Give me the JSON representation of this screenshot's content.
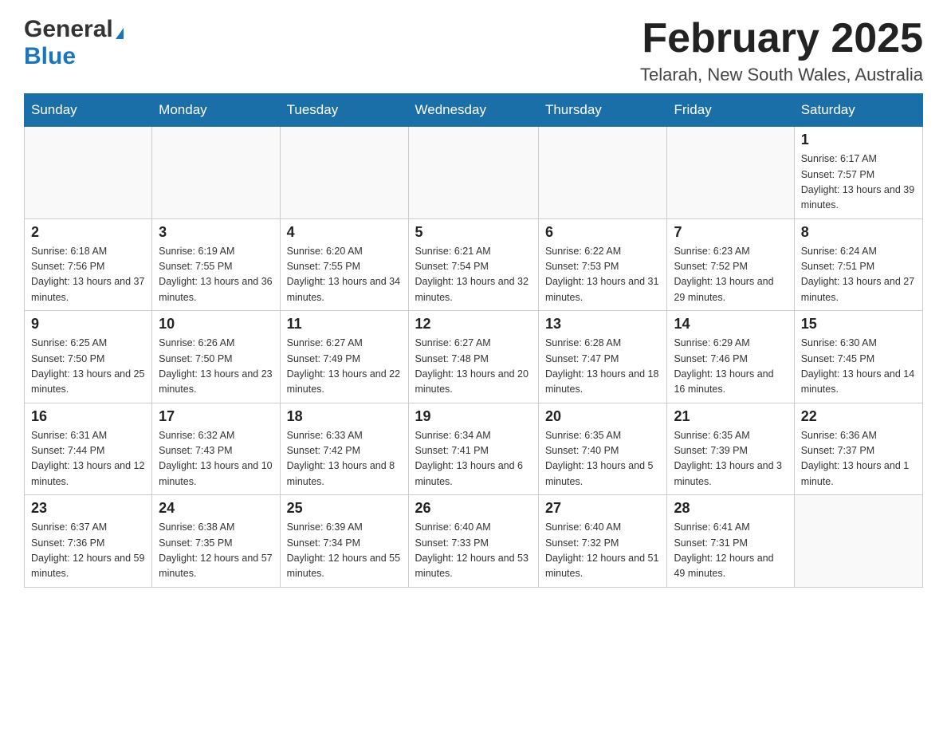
{
  "header": {
    "logo_general": "General",
    "logo_blue": "Blue",
    "month_title": "February 2025",
    "location": "Telarah, New South Wales, Australia"
  },
  "weekdays": [
    "Sunday",
    "Monday",
    "Tuesday",
    "Wednesday",
    "Thursday",
    "Friday",
    "Saturday"
  ],
  "weeks": [
    [
      {
        "day": "",
        "sunrise": "",
        "sunset": "",
        "daylight": ""
      },
      {
        "day": "",
        "sunrise": "",
        "sunset": "",
        "daylight": ""
      },
      {
        "day": "",
        "sunrise": "",
        "sunset": "",
        "daylight": ""
      },
      {
        "day": "",
        "sunrise": "",
        "sunset": "",
        "daylight": ""
      },
      {
        "day": "",
        "sunrise": "",
        "sunset": "",
        "daylight": ""
      },
      {
        "day": "",
        "sunrise": "",
        "sunset": "",
        "daylight": ""
      },
      {
        "day": "1",
        "sunrise": "Sunrise: 6:17 AM",
        "sunset": "Sunset: 7:57 PM",
        "daylight": "Daylight: 13 hours and 39 minutes."
      }
    ],
    [
      {
        "day": "2",
        "sunrise": "Sunrise: 6:18 AM",
        "sunset": "Sunset: 7:56 PM",
        "daylight": "Daylight: 13 hours and 37 minutes."
      },
      {
        "day": "3",
        "sunrise": "Sunrise: 6:19 AM",
        "sunset": "Sunset: 7:55 PM",
        "daylight": "Daylight: 13 hours and 36 minutes."
      },
      {
        "day": "4",
        "sunrise": "Sunrise: 6:20 AM",
        "sunset": "Sunset: 7:55 PM",
        "daylight": "Daylight: 13 hours and 34 minutes."
      },
      {
        "day": "5",
        "sunrise": "Sunrise: 6:21 AM",
        "sunset": "Sunset: 7:54 PM",
        "daylight": "Daylight: 13 hours and 32 minutes."
      },
      {
        "day": "6",
        "sunrise": "Sunrise: 6:22 AM",
        "sunset": "Sunset: 7:53 PM",
        "daylight": "Daylight: 13 hours and 31 minutes."
      },
      {
        "day": "7",
        "sunrise": "Sunrise: 6:23 AM",
        "sunset": "Sunset: 7:52 PM",
        "daylight": "Daylight: 13 hours and 29 minutes."
      },
      {
        "day": "8",
        "sunrise": "Sunrise: 6:24 AM",
        "sunset": "Sunset: 7:51 PM",
        "daylight": "Daylight: 13 hours and 27 minutes."
      }
    ],
    [
      {
        "day": "9",
        "sunrise": "Sunrise: 6:25 AM",
        "sunset": "Sunset: 7:50 PM",
        "daylight": "Daylight: 13 hours and 25 minutes."
      },
      {
        "day": "10",
        "sunrise": "Sunrise: 6:26 AM",
        "sunset": "Sunset: 7:50 PM",
        "daylight": "Daylight: 13 hours and 23 minutes."
      },
      {
        "day": "11",
        "sunrise": "Sunrise: 6:27 AM",
        "sunset": "Sunset: 7:49 PM",
        "daylight": "Daylight: 13 hours and 22 minutes."
      },
      {
        "day": "12",
        "sunrise": "Sunrise: 6:27 AM",
        "sunset": "Sunset: 7:48 PM",
        "daylight": "Daylight: 13 hours and 20 minutes."
      },
      {
        "day": "13",
        "sunrise": "Sunrise: 6:28 AM",
        "sunset": "Sunset: 7:47 PM",
        "daylight": "Daylight: 13 hours and 18 minutes."
      },
      {
        "day": "14",
        "sunrise": "Sunrise: 6:29 AM",
        "sunset": "Sunset: 7:46 PM",
        "daylight": "Daylight: 13 hours and 16 minutes."
      },
      {
        "day": "15",
        "sunrise": "Sunrise: 6:30 AM",
        "sunset": "Sunset: 7:45 PM",
        "daylight": "Daylight: 13 hours and 14 minutes."
      }
    ],
    [
      {
        "day": "16",
        "sunrise": "Sunrise: 6:31 AM",
        "sunset": "Sunset: 7:44 PM",
        "daylight": "Daylight: 13 hours and 12 minutes."
      },
      {
        "day": "17",
        "sunrise": "Sunrise: 6:32 AM",
        "sunset": "Sunset: 7:43 PM",
        "daylight": "Daylight: 13 hours and 10 minutes."
      },
      {
        "day": "18",
        "sunrise": "Sunrise: 6:33 AM",
        "sunset": "Sunset: 7:42 PM",
        "daylight": "Daylight: 13 hours and 8 minutes."
      },
      {
        "day": "19",
        "sunrise": "Sunrise: 6:34 AM",
        "sunset": "Sunset: 7:41 PM",
        "daylight": "Daylight: 13 hours and 6 minutes."
      },
      {
        "day": "20",
        "sunrise": "Sunrise: 6:35 AM",
        "sunset": "Sunset: 7:40 PM",
        "daylight": "Daylight: 13 hours and 5 minutes."
      },
      {
        "day": "21",
        "sunrise": "Sunrise: 6:35 AM",
        "sunset": "Sunset: 7:39 PM",
        "daylight": "Daylight: 13 hours and 3 minutes."
      },
      {
        "day": "22",
        "sunrise": "Sunrise: 6:36 AM",
        "sunset": "Sunset: 7:37 PM",
        "daylight": "Daylight: 13 hours and 1 minute."
      }
    ],
    [
      {
        "day": "23",
        "sunrise": "Sunrise: 6:37 AM",
        "sunset": "Sunset: 7:36 PM",
        "daylight": "Daylight: 12 hours and 59 minutes."
      },
      {
        "day": "24",
        "sunrise": "Sunrise: 6:38 AM",
        "sunset": "Sunset: 7:35 PM",
        "daylight": "Daylight: 12 hours and 57 minutes."
      },
      {
        "day": "25",
        "sunrise": "Sunrise: 6:39 AM",
        "sunset": "Sunset: 7:34 PM",
        "daylight": "Daylight: 12 hours and 55 minutes."
      },
      {
        "day": "26",
        "sunrise": "Sunrise: 6:40 AM",
        "sunset": "Sunset: 7:33 PM",
        "daylight": "Daylight: 12 hours and 53 minutes."
      },
      {
        "day": "27",
        "sunrise": "Sunrise: 6:40 AM",
        "sunset": "Sunset: 7:32 PM",
        "daylight": "Daylight: 12 hours and 51 minutes."
      },
      {
        "day": "28",
        "sunrise": "Sunrise: 6:41 AM",
        "sunset": "Sunset: 7:31 PM",
        "daylight": "Daylight: 12 hours and 49 minutes."
      },
      {
        "day": "",
        "sunrise": "",
        "sunset": "",
        "daylight": ""
      }
    ]
  ]
}
